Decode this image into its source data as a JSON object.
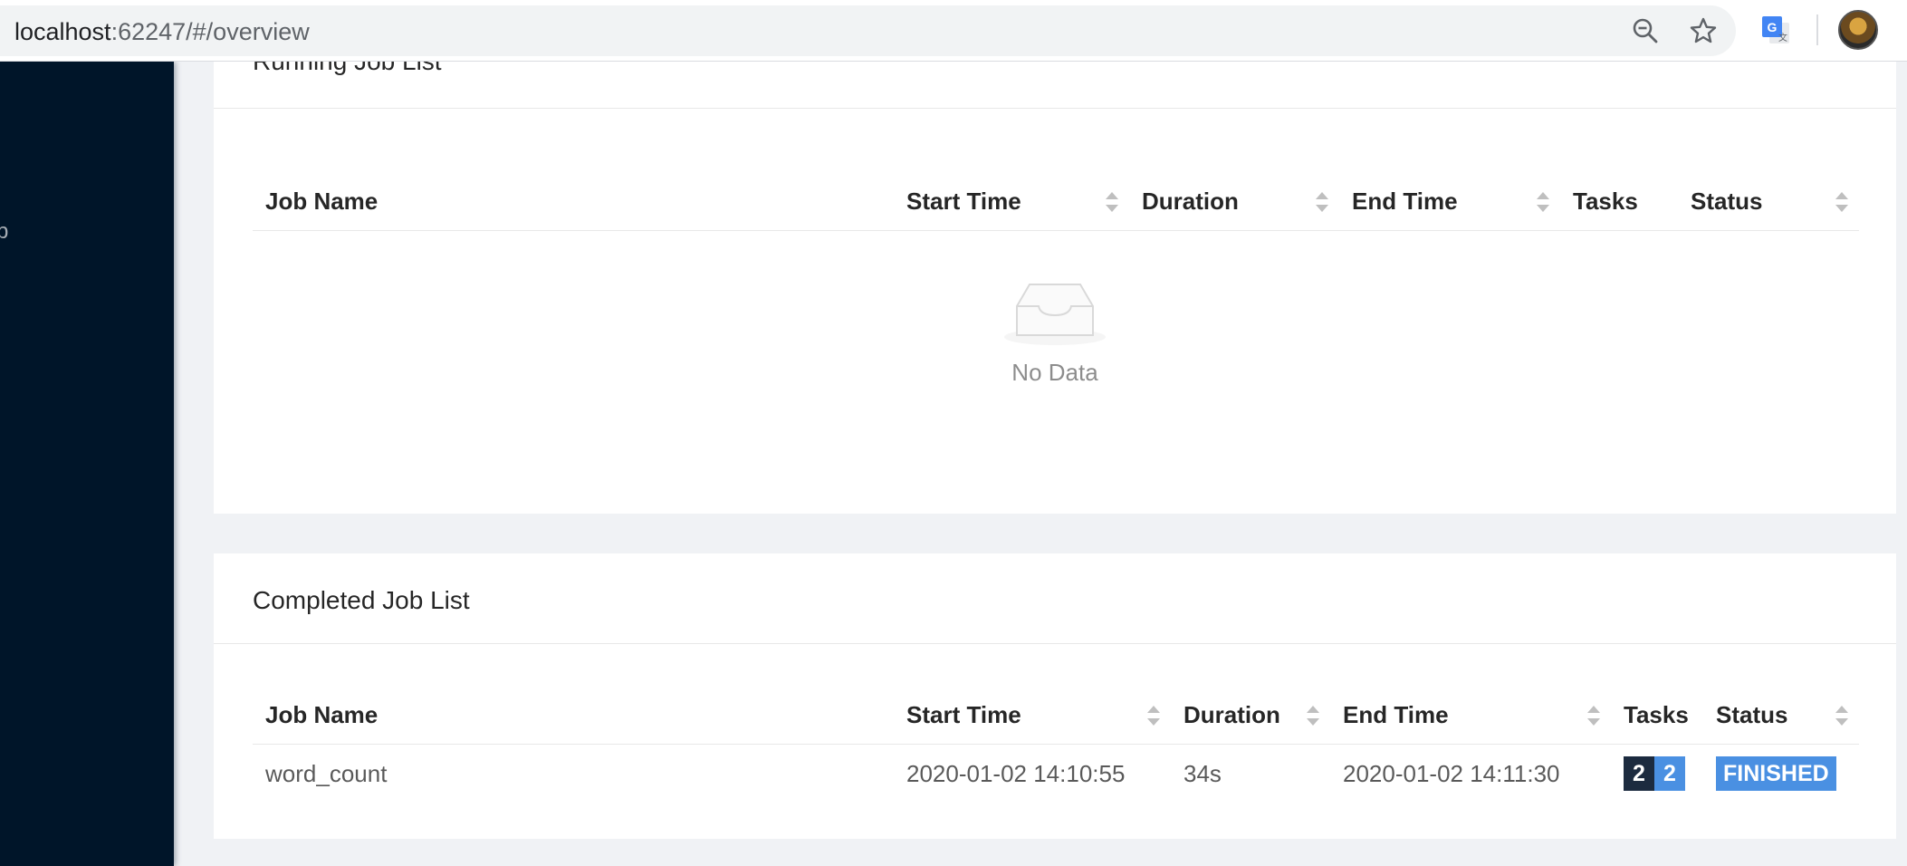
{
  "browser": {
    "url_host": "localhost",
    "url_path": ":62247/#/overview"
  },
  "sidebar": {
    "clipped_text": "b"
  },
  "running_jobs": {
    "title": "Running Job List",
    "columns": [
      "Job Name",
      "Start Time",
      "Duration",
      "End Time",
      "Tasks",
      "Status"
    ],
    "empty_text": "No Data",
    "rows": []
  },
  "completed_jobs": {
    "title": "Completed Job List",
    "columns": [
      "Job Name",
      "Start Time",
      "Duration",
      "End Time",
      "Tasks",
      "Status"
    ],
    "rows": [
      {
        "job_name": "word_count",
        "start_time": "2020-01-02 14:10:55",
        "duration": "34s",
        "end_time": "2020-01-02 14:11:30",
        "tasks": [
          {
            "count": "2",
            "color": "#1c2b3f"
          },
          {
            "count": "2",
            "color": "#4a90e2"
          }
        ],
        "status": "FINISHED",
        "status_color": "#4a90e2"
      }
    ]
  },
  "icons": {
    "zoom": "zoom-out-icon",
    "star": "bookmark-star-icon",
    "translate": "google-translate-icon",
    "empty": "empty-inbox-icon",
    "sort": "sort-caret-icon"
  }
}
